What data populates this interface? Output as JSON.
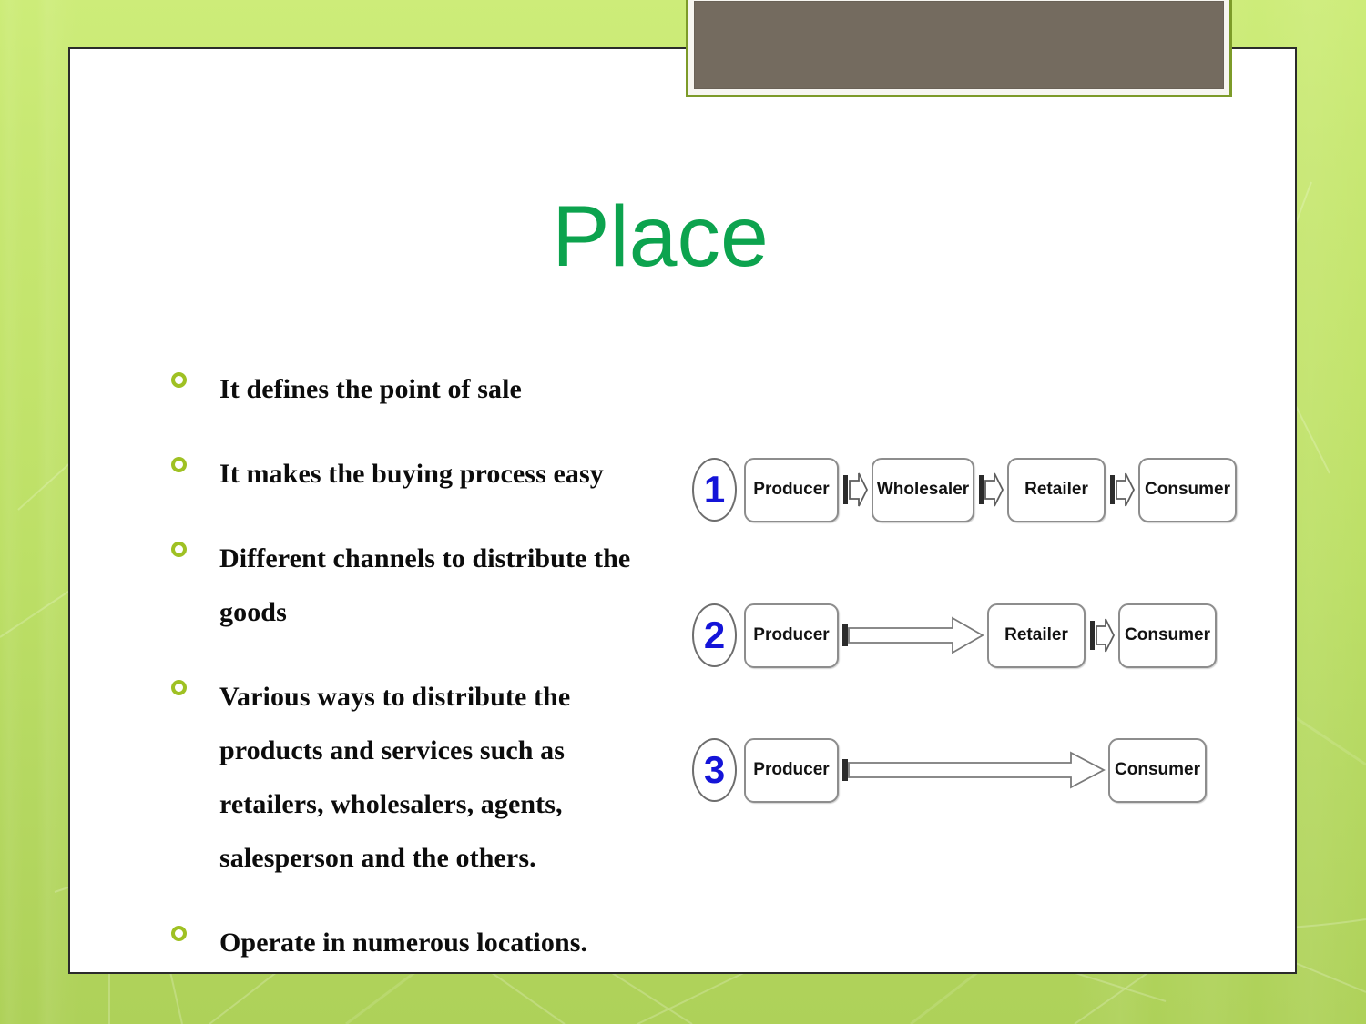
{
  "slide": {
    "title": "Place",
    "title_color": "#0CA34E",
    "bullet_color": "#9FC123",
    "panel_background": "#FFFFFF",
    "background_top_color": "#CDEC79",
    "background_bottom_color": "#AED159"
  },
  "picture_placeholder": {
    "name": "decorative-image",
    "fill_color": "#746B5F",
    "frame_color": "#7D9B29"
  },
  "bullets": [
    {
      "text": "It defines the point of sale"
    },
    {
      "text": "It makes the buying process easy"
    },
    {
      "text": "Different channels to distribute the goods"
    },
    {
      "text": "Various ways to distribute the products and services such as retailers, wholesalers, agents, salesperson and the others."
    },
    {
      "text": "Operate in numerous locations."
    }
  ],
  "diagram": {
    "title": "distribution-channels",
    "number_color": "#1414D8",
    "rows": [
      {
        "number": "1",
        "nodes": [
          "Producer",
          "Wholesaler",
          "Retailer",
          "Consumer"
        ],
        "connectors": [
          "chevron",
          "chevron",
          "chevron"
        ]
      },
      {
        "number": "2",
        "nodes": [
          "Producer",
          "Retailer",
          "Consumer"
        ],
        "connectors": [
          "long-arrow",
          "chevron"
        ]
      },
      {
        "number": "3",
        "nodes": [
          "Producer",
          "Consumer"
        ],
        "connectors": [
          "long-arrow"
        ]
      }
    ]
  }
}
